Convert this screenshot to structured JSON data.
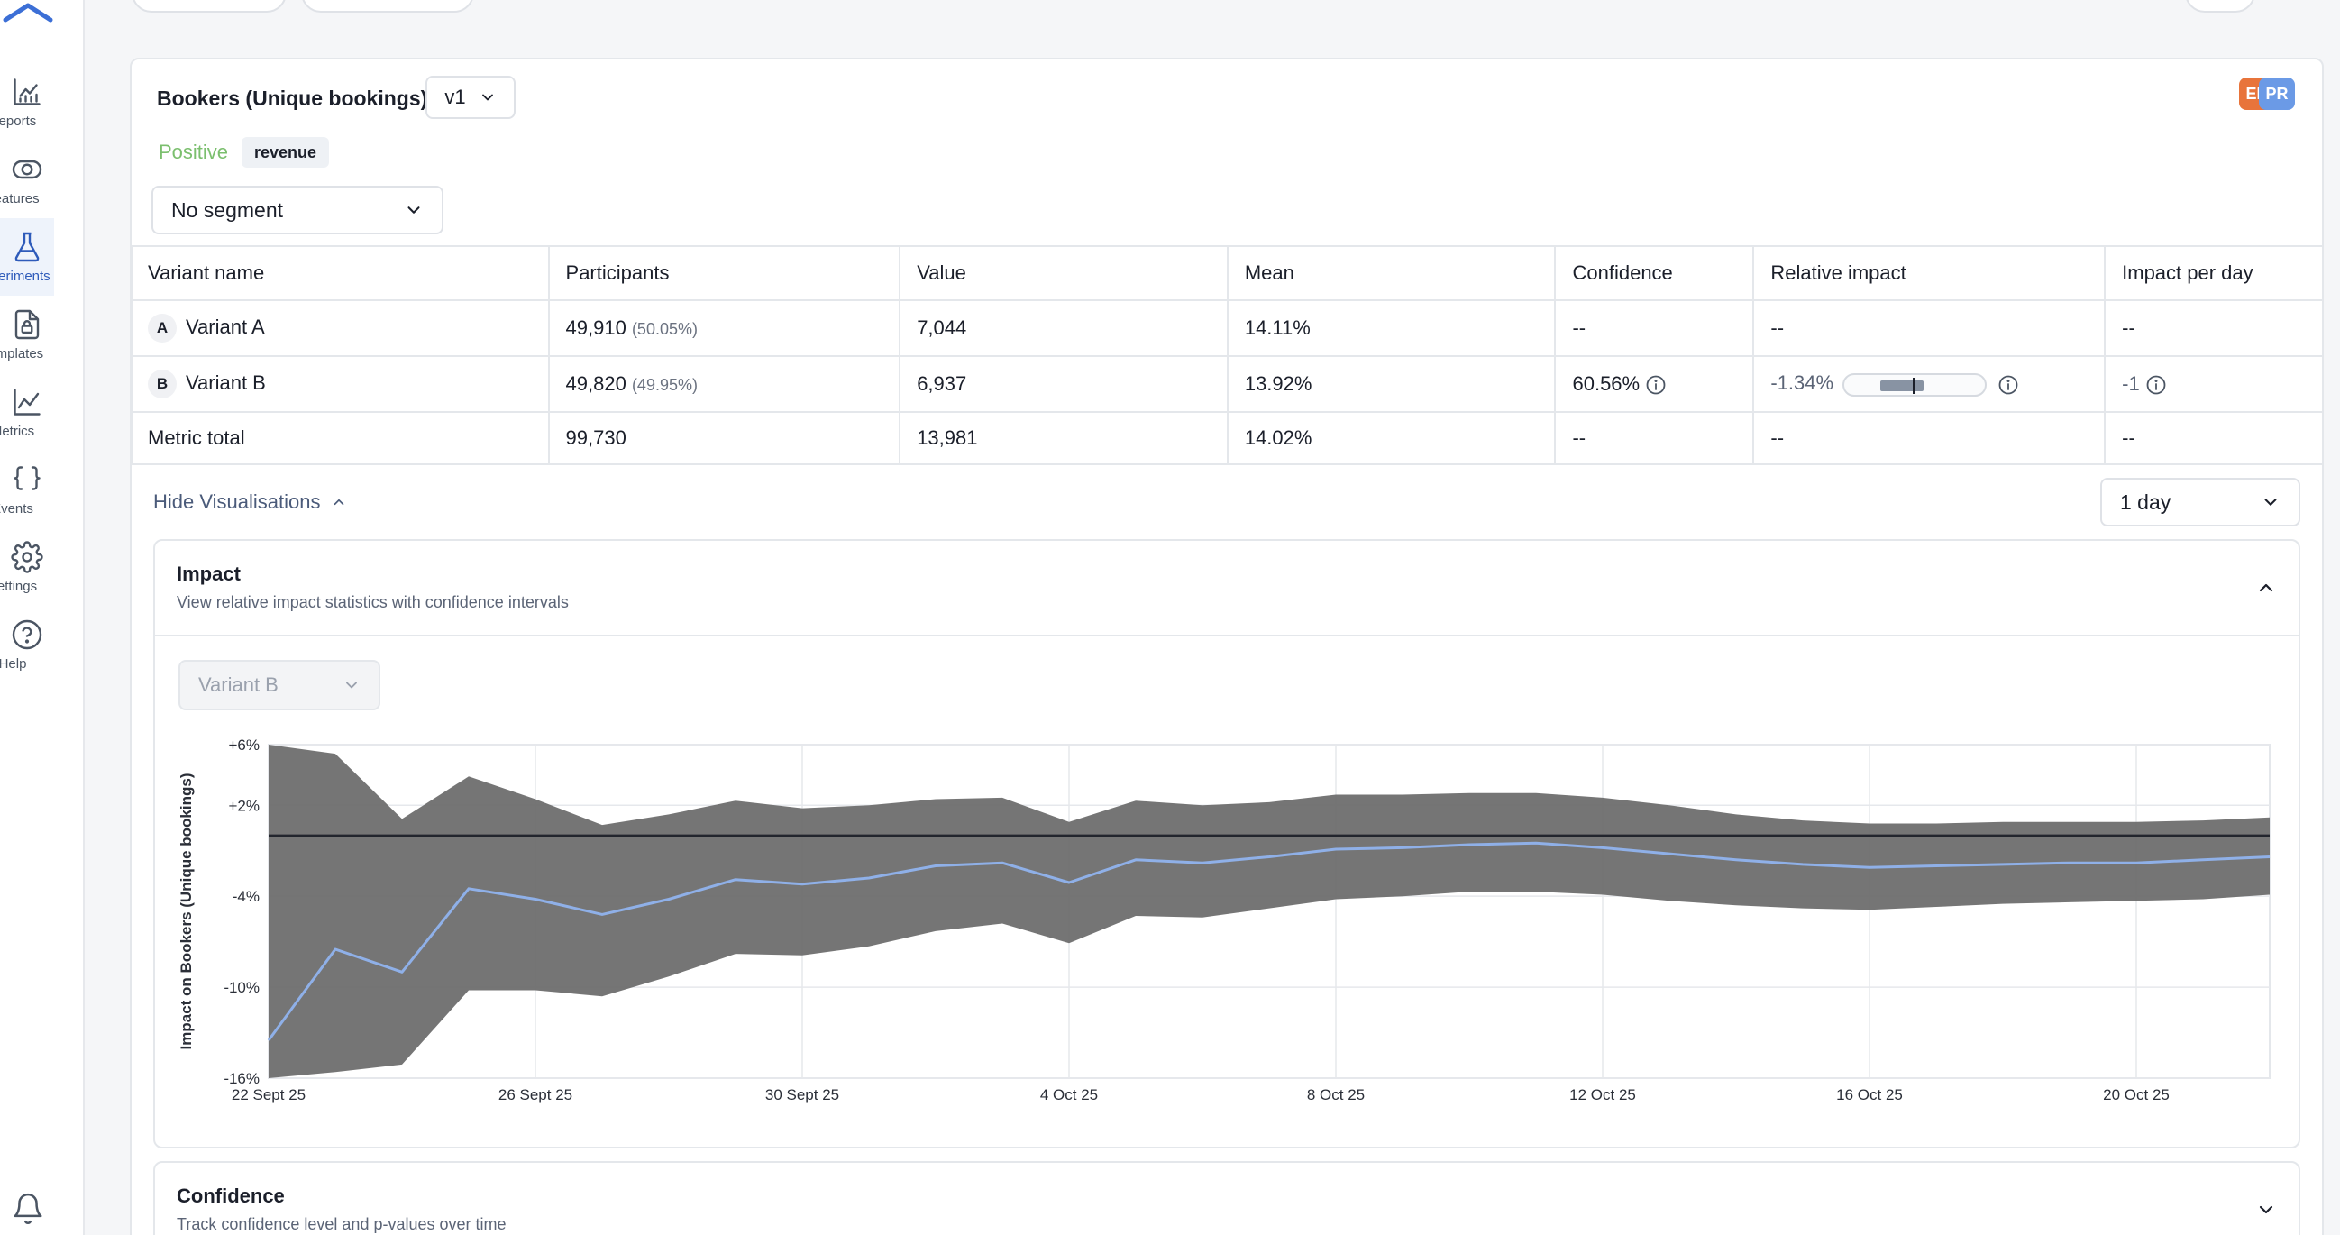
{
  "colors": {
    "accent": "#2e5bba",
    "positive": "#7bbf6e",
    "band": "#6e6e6e",
    "mean_line": "#8fb0e8",
    "avatar_en": "#e8743b",
    "avatar_pr": "#6b9ae6"
  },
  "sidebar": {
    "items": [
      {
        "label": "Reports",
        "icon": "chart-icon"
      },
      {
        "label": "Features",
        "icon": "toggle-icon"
      },
      {
        "label": "Experiments",
        "icon": "flask-icon",
        "active": true
      },
      {
        "label": "Templates",
        "icon": "template-icon"
      },
      {
        "label": "Metrics",
        "icon": "line-chart-icon"
      },
      {
        "label": "Events",
        "icon": "braces-icon"
      },
      {
        "label": "Settings",
        "icon": "gear-icon"
      },
      {
        "label": "Help",
        "icon": "help-icon"
      }
    ]
  },
  "metric": {
    "title": "Bookers (Unique bookings)",
    "version": "v1",
    "direction": "Positive",
    "tag": "revenue",
    "avatars": [
      "EN",
      "PR"
    ]
  },
  "segment": {
    "selected": "No segment"
  },
  "table": {
    "headers": [
      "Variant name",
      "Participants",
      "Value",
      "Mean",
      "Confidence",
      "Relative impact",
      "Impact per day"
    ],
    "rows": [
      {
        "badge": "A",
        "name": "Variant A",
        "participants": "49,910",
        "participants_pct": "(50.05%)",
        "value": "7,044",
        "mean": "14.11%",
        "confidence": "--",
        "relative_impact": "--",
        "impact_per_day": "--"
      },
      {
        "badge": "B",
        "name": "Variant B",
        "participants": "49,820",
        "participants_pct": "(49.95%)",
        "value": "6,937",
        "mean": "13.92%",
        "confidence": "60.56%",
        "relative_impact": "-1.34%",
        "impact_per_day": "-1"
      }
    ],
    "total": {
      "name": "Metric total",
      "participants": "99,730",
      "value": "13,981",
      "mean": "14.02%",
      "confidence": "--",
      "relative_impact": "--",
      "impact_per_day": "--"
    }
  },
  "visualisations": {
    "toggle_label": "Hide Visualisations",
    "period": "1 day",
    "impact_panel": {
      "title": "Impact",
      "subtitle": "View relative impact statistics with confidence intervals",
      "variant": "Variant B"
    },
    "confidence_panel": {
      "title": "Confidence",
      "subtitle": "Track confidence level and p-values over time"
    }
  },
  "chart_data": {
    "type": "area",
    "ylabel": "Impact on Bookers (Unique bookings)",
    "y_ticks": [
      6,
      2,
      -4,
      -10,
      -16
    ],
    "y_tick_labels": [
      "+6%",
      "+2%",
      "-4%",
      "-10%",
      "-16%"
    ],
    "ylim": [
      -16,
      6
    ],
    "x_tick_labels": [
      "22 Sept 25",
      "26 Sept 25",
      "30 Sept 25",
      "4 Oct 25",
      "8 Oct 25",
      "12 Oct 25",
      "16 Oct 25",
      "20 Oct 25"
    ],
    "x_tick_days": [
      0,
      4,
      8,
      12,
      16,
      20,
      24,
      28
    ],
    "x_days": [
      0,
      1,
      2,
      3,
      4,
      5,
      6,
      7,
      8,
      9,
      10,
      11,
      12,
      13,
      14,
      15,
      16,
      17,
      18,
      19,
      20,
      21,
      22,
      23,
      24,
      25,
      26,
      27,
      28,
      29,
      30
    ],
    "series": [
      {
        "role": "mean",
        "values": [
          -13.5,
          -7.5,
          -9.0,
          -3.5,
          -4.2,
          -5.2,
          -4.2,
          -2.9,
          -3.2,
          -2.8,
          -2.0,
          -1.8,
          -3.1,
          -1.6,
          -1.8,
          -1.4,
          -0.9,
          -0.8,
          -0.6,
          -0.5,
          -0.8,
          -1.2,
          -1.6,
          -1.9,
          -2.1,
          -2.0,
          -1.9,
          -1.8,
          -1.8,
          -1.6,
          -1.4
        ]
      },
      {
        "role": "upper",
        "values": [
          6.0,
          5.4,
          1.1,
          3.9,
          2.4,
          0.7,
          1.4,
          2.3,
          1.8,
          2.0,
          2.4,
          2.5,
          0.9,
          2.3,
          2.0,
          2.2,
          2.7,
          2.7,
          2.8,
          2.8,
          2.5,
          2.0,
          1.4,
          1.0,
          0.8,
          0.8,
          0.9,
          0.9,
          0.9,
          1.0,
          1.2
        ]
      },
      {
        "role": "lower",
        "values": [
          -16.0,
          -15.6,
          -15.1,
          -10.2,
          -10.2,
          -10.6,
          -9.3,
          -7.8,
          -7.9,
          -7.3,
          -6.3,
          -5.8,
          -7.1,
          -5.3,
          -5.4,
          -4.8,
          -4.2,
          -4.0,
          -3.7,
          -3.7,
          -3.9,
          -4.3,
          -4.6,
          -4.8,
          -4.9,
          -4.7,
          -4.5,
          -4.4,
          -4.3,
          -4.2,
          -3.9
        ]
      }
    ],
    "reference_line": 0,
    "grid": true
  }
}
